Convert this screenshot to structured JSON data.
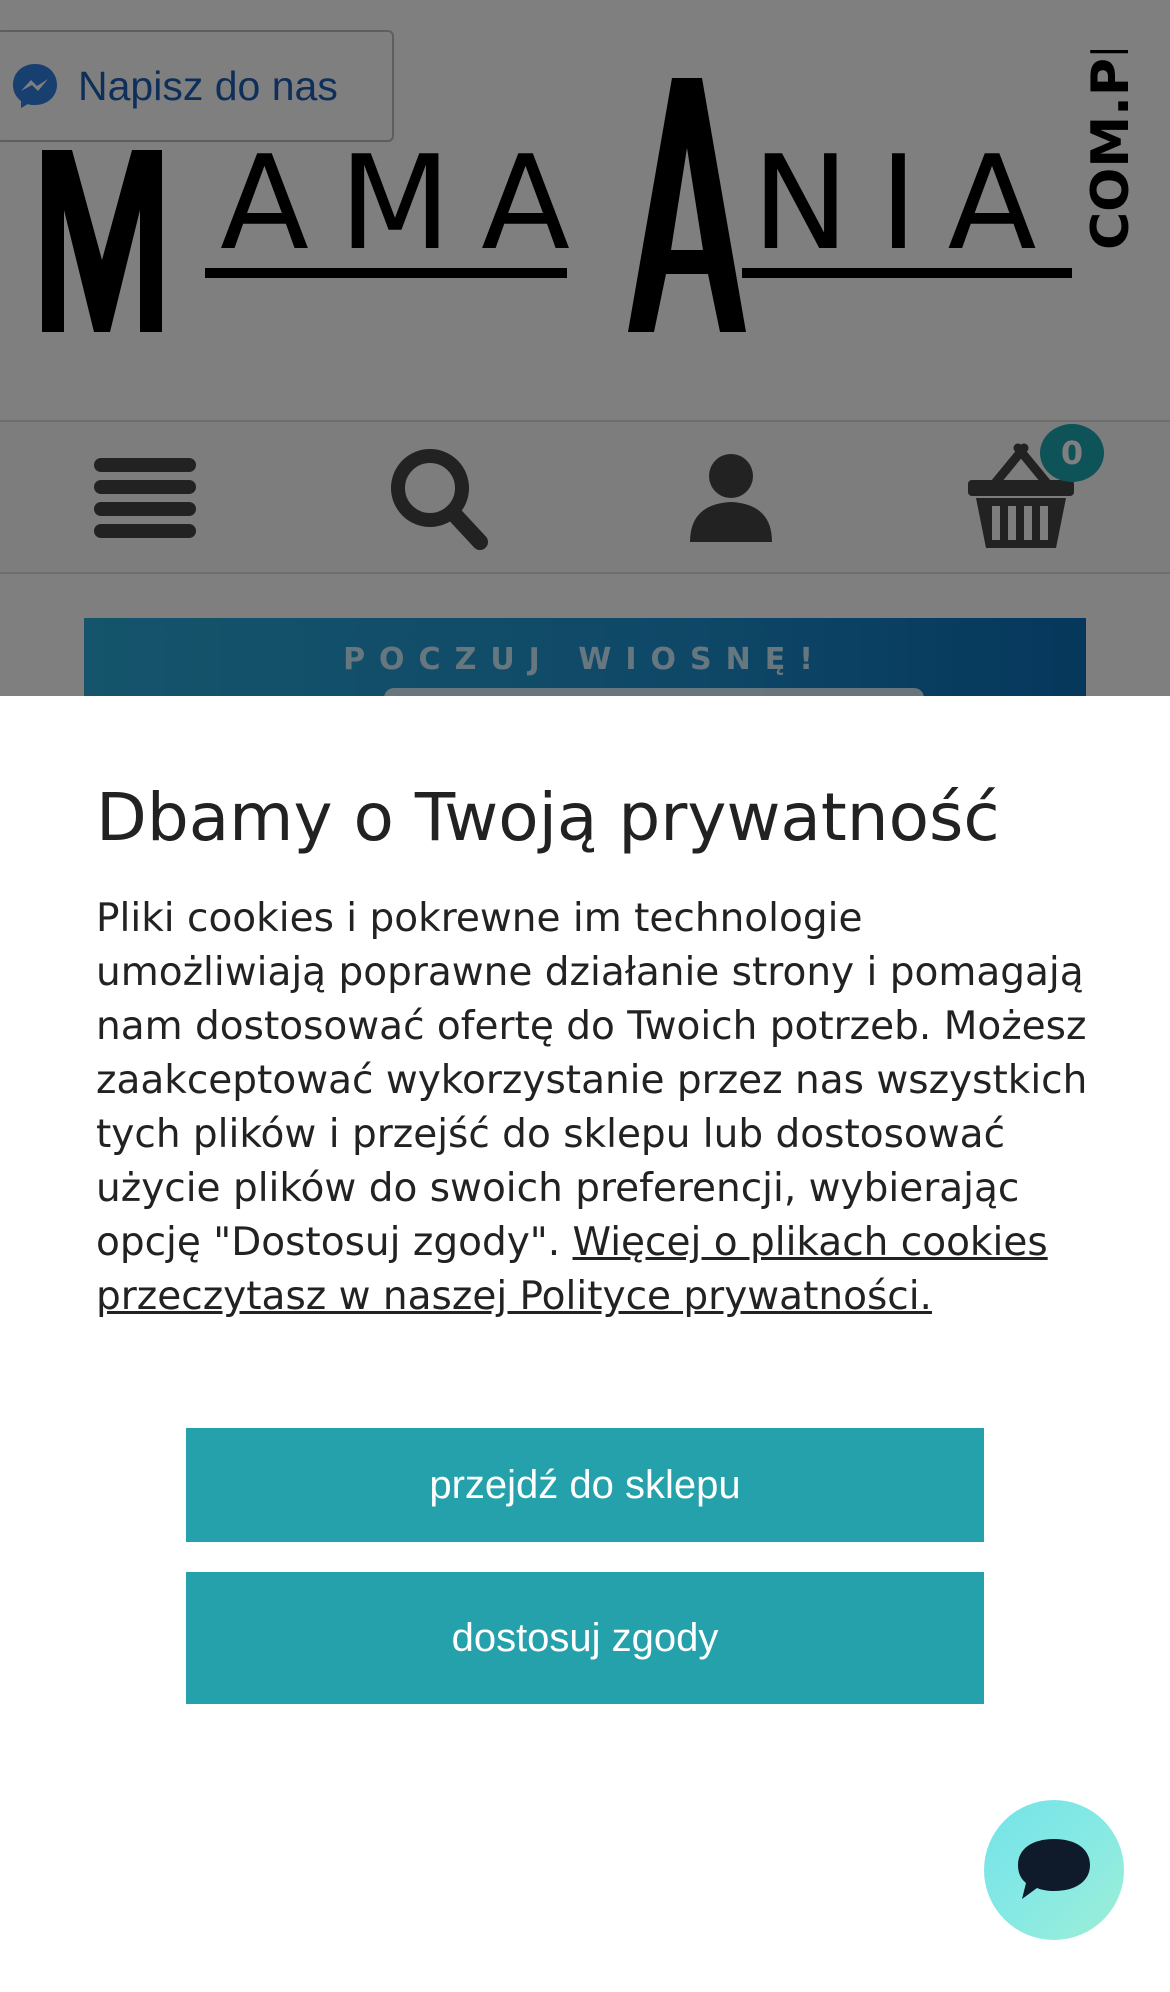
{
  "messenger": {
    "label": "Napisz do nas",
    "icon": "messenger-icon",
    "color": "#1f5fb6"
  },
  "logo": {
    "text": "MAMAANIA",
    "domain": "COM.PL"
  },
  "nav": {
    "menu_icon": "hamburger-icon",
    "search_icon": "search-icon",
    "account_icon": "user-icon",
    "cart_icon": "basket-icon",
    "cart_count": "0"
  },
  "promo": {
    "text": "POCZUJ WIOSNĘ!"
  },
  "cookie": {
    "title": "Dbamy o Twoją prywatność",
    "body": "Pliki cookies i pokrewne im technologie umożliwiają poprawne działanie strony i pomagają nam dostosować ofertę do Twoich potrzeb. Możesz zaakceptować wykorzystanie przez nas wszystkich tych plików i przejść do sklepu lub dostosować użycie plików do swoich preferencji, wybierając opcję \"Dostosuj zgody\".",
    "link_text": "Więcej o plikach cookies przeczytasz w naszej Polityce prywatności.",
    "btn_shop": "przejdź do sklepu",
    "btn_consent": "dostosuj zgody"
  },
  "chat": {
    "icon": "chat-icon"
  },
  "colors": {
    "accent": "#24a1aa",
    "badge": "#1aa6b0",
    "banner": "#1e90cf"
  }
}
